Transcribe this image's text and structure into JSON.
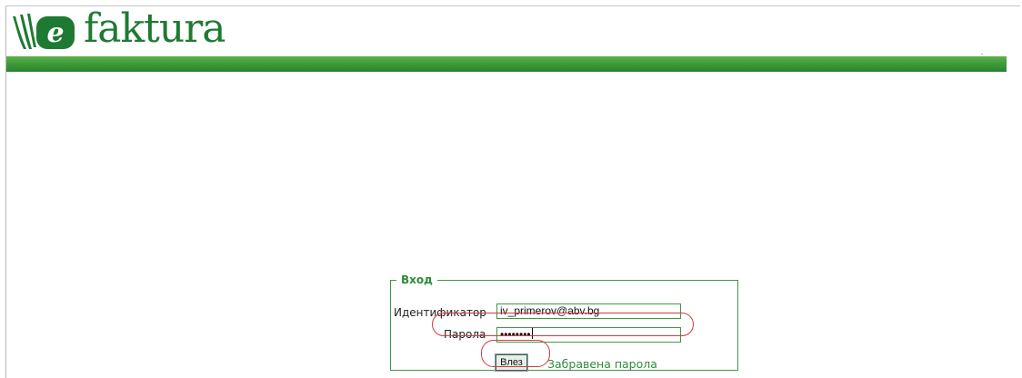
{
  "brand": {
    "prefix": "e",
    "name": "faktura",
    "color": "#1e7a32"
  },
  "header_bar": {
    "color": "#3f9b3a"
  },
  "login": {
    "legend": "Вход",
    "id_label": "Идентификатор",
    "id_value": "iv_primerov@abv.bg",
    "password_label": "Парола",
    "password_masked": "••••••••",
    "submit_label": "Влез",
    "forgot_link": "Забравена парола"
  },
  "highlight_color": "#d63a3a"
}
